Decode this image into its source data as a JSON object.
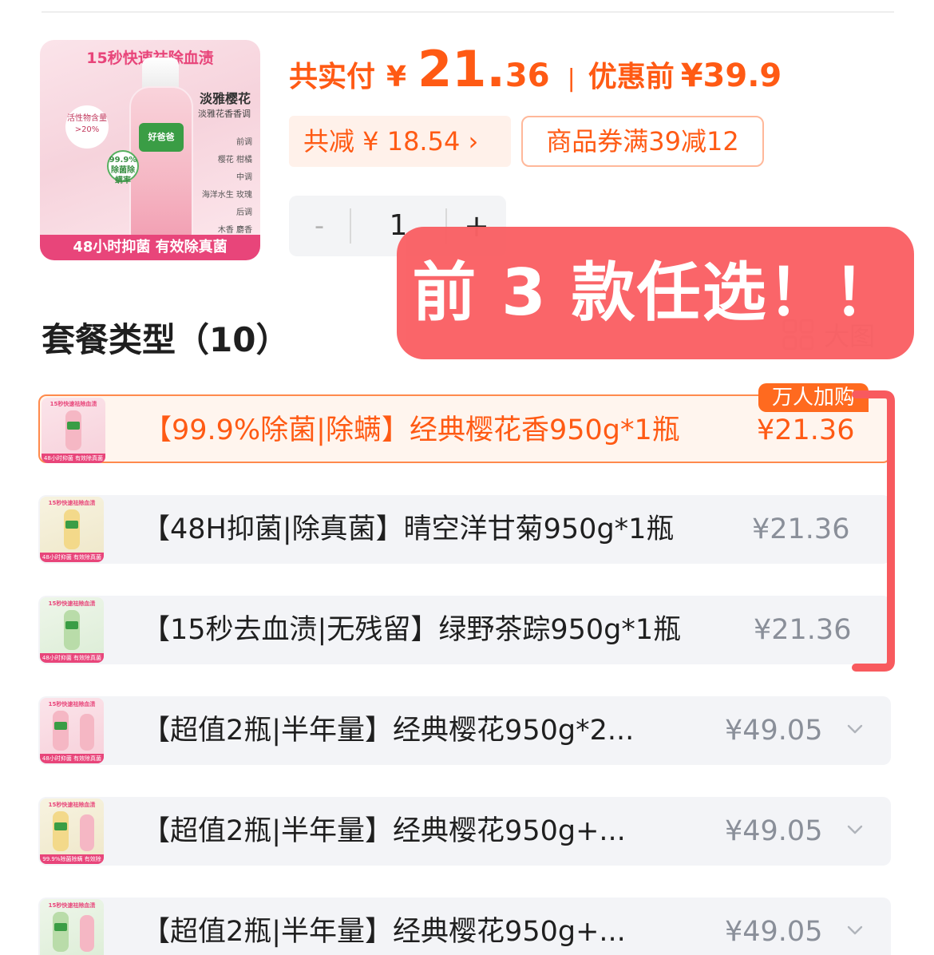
{
  "product": {
    "thumb_title": "15秒快速祛除血渍",
    "thumb_name": "淡雅樱花",
    "thumb_sub": "淡雅花香香调",
    "thumb_label": "好爸爸",
    "thumb_badge_left": "活性物含量 >20%",
    "thumb_badge_round": "99.9% 除菌除螨率",
    "thumb_notes": [
      "前调",
      "樱花 柑橘",
      "中调",
      "海洋水生 玫瑰",
      "后调",
      "木香 麝香"
    ],
    "thumb_banner": "48小时抑菌 有效除真菌"
  },
  "price": {
    "paid_label": "共实付",
    "yen": "¥",
    "paid_int": "21.",
    "paid_dec": "36",
    "separator": "|",
    "prev_label": "优惠前",
    "prev_value": "¥39.9",
    "colors": {
      "accent": "#ff5a14",
      "chip_bg": "#fff1ea"
    }
  },
  "saving": {
    "label": "共减 ¥ 18.54 ›"
  },
  "coupon": {
    "label": "商品券满39减12"
  },
  "quantity": {
    "minus": "-",
    "value": "1",
    "plus": "+"
  },
  "section": {
    "title": "套餐类型（10）",
    "big_view": "大图"
  },
  "overlay": {
    "text": "前 3 款任选！！",
    "color": "#fa6165"
  },
  "hot_tag": "万人加购",
  "options": [
    {
      "name": "【99.9%除菌|除螨】经典樱花香950g*1瓶",
      "price": "¥21.36",
      "selected": true,
      "variant": "pink",
      "thumb_top": "15秒快速祛除血渍",
      "thumb_bottom": "48小时抑菌 有效除真菌"
    },
    {
      "name": "【48H抑菌|除真菌】晴空洋甘菊950g*1瓶",
      "price": "¥21.36",
      "selected": false,
      "variant": "yellow",
      "thumb_top": "15秒快速祛除血渍",
      "thumb_bottom": "48小时抑菌 有效除真菌"
    },
    {
      "name": "【15秒去血渍|无残留】绿野茶踪950g*1瓶",
      "price": "¥21.36",
      "selected": false,
      "variant": "green",
      "thumb_top": "15秒快速祛除血渍",
      "thumb_bottom": "48小时抑菌 有效除真菌"
    },
    {
      "name": "【超值2瓶|半年量】经典樱花950g*2...",
      "price": "¥49.05",
      "selected": false,
      "variant": "pink-double",
      "thumb_top": "15秒快速祛除血渍",
      "thumb_bottom": "48小时抑菌 有效除真菌"
    },
    {
      "name": "【超值2瓶|半年量】经典樱花950g+...",
      "price": "¥49.05",
      "selected": false,
      "variant": "mixed-double",
      "thumb_top": "15秒快速祛除血渍",
      "thumb_bottom": "99.9%除菌除螨 有效除真菌"
    },
    {
      "name": "【超值2瓶|半年量】经典樱花950g+...",
      "price": "¥49.05",
      "selected": false,
      "variant": "mixed-double-green",
      "thumb_top": "15秒快速祛除血渍",
      "thumb_bottom": ""
    }
  ],
  "icons": {
    "chevron": "chevron-down-icon",
    "bigview": "grid-icon"
  }
}
